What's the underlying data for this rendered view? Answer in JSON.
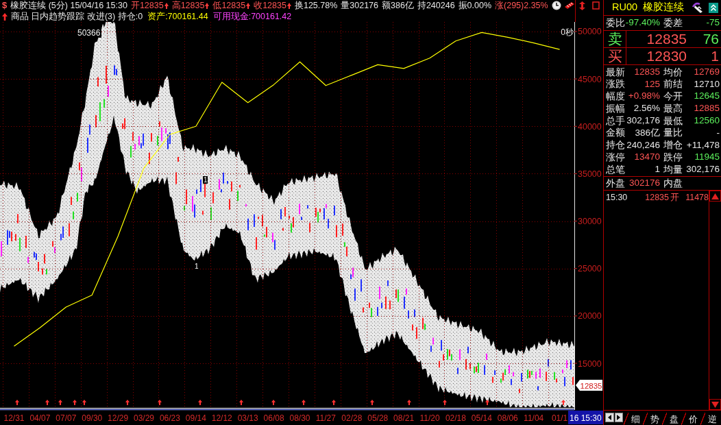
{
  "quote_bar": {
    "glyph": "$",
    "items": [
      {
        "text": "橡胶连续 (5分) 15/04/16 15:30"
      },
      {
        "text": "开12835",
        "color": "#ff5555",
        "marker": true
      },
      {
        "text": "高12835",
        "color": "#ff5555",
        "marker": true
      },
      {
        "text": "低12835",
        "color": "#ff5555",
        "marker": true
      },
      {
        "text": "收12835",
        "color": "#ff5555",
        "marker": true
      },
      {
        "text": "换125.78%"
      },
      {
        "text": "量302176"
      },
      {
        "text": "额386亿"
      },
      {
        "text": "持240246"
      },
      {
        "text": "振0.00%"
      },
      {
        "text": "涨(295)2.35%",
        "color": "#ff5555"
      }
    ]
  },
  "strategy_bar": {
    "items": [
      {
        "text": "商品 日内趋势跟踪 改进(3) 持仓:0"
      },
      {
        "text": "资产:700161.44",
        "color": "#ffff00"
      },
      {
        "text": "可用现金:700161.42",
        "color": "#ff44ff"
      }
    ]
  },
  "chart": {
    "high_label": "50366",
    "countdown": "0秒",
    "price_tag": "12835",
    "time_tag": "16 15:30",
    "chart_data": {
      "type": "line",
      "categories": [
        "12/31",
        "04/07",
        "07/07",
        "09/30",
        "12/29",
        "03/29",
        "06/23",
        "09/14",
        "12/12",
        "03/13",
        "06/08",
        "08/30",
        "11/27",
        "02/28",
        "05/28",
        "08/21",
        "11/20",
        "02/18",
        "05/14",
        "08/06",
        "11/04",
        "01/1"
      ],
      "ylim": [
        10230,
        51010
      ],
      "yticks": [
        15000,
        20000,
        25000,
        30000,
        35000,
        40000,
        45000,
        50000
      ],
      "grid": true,
      "series": [
        {
          "color": "#ffff00",
          "values": [
            16800,
            18760,
            20930,
            22200,
            28400,
            35600,
            39150,
            40000,
            44650,
            42500,
            44400,
            46800,
            44300,
            45400,
            46500,
            46100,
            47200,
            49000,
            49900,
            49400,
            48800,
            48100
          ]
        }
      ],
      "annotations": [
        "1",
        "1"
      ]
    }
  },
  "quote_panel": {
    "code": "RU00",
    "name": "橡胶连续",
    "ratio": [
      {
        "label": "委比",
        "value": "-97.40%",
        "color": "#5cf05c"
      },
      {
        "label": "委差",
        "value": "-75",
        "color": "#5cf05c"
      }
    ],
    "book": [
      {
        "label": {
          "text": "卖",
          "color": "#5cf05c"
        },
        "price": {
          "text": "12835",
          "color": "#ff5555"
        },
        "volume": {
          "text": "76",
          "color": "#5cf05c"
        }
      },
      {
        "label": {
          "text": "买",
          "color": "#ff5555"
        },
        "price": {
          "text": "12830",
          "color": "#ff5555"
        },
        "volume": {
          "text": "1",
          "color": "#ff5555"
        }
      }
    ],
    "stats": [
      {
        "label": "最新",
        "value": "12835",
        "color": "#ff5555"
      },
      {
        "label": "均价",
        "value": "12769",
        "color": "#ff5555"
      },
      {
        "label": "涨跌",
        "value": "125",
        "color": "#ff5555"
      },
      {
        "label": "前结",
        "value": "12710"
      },
      {
        "label": "幅度",
        "value": "+0.98%",
        "color": "#ff5555"
      },
      {
        "label": "今开",
        "value": "12645",
        "color": "#5cf05c"
      },
      {
        "label": "振幅",
        "value": "2.56%"
      },
      {
        "label": "最高",
        "value": "12885",
        "color": "#ff5555"
      },
      {
        "label": "总手",
        "value": "302,176"
      },
      {
        "label": "最低",
        "value": "12560",
        "color": "#5cf05c"
      },
      {
        "label": "金额",
        "value": "386亿"
      },
      {
        "label": "量比",
        "value": "-"
      },
      {
        "label": "持仓",
        "value": "240,246"
      },
      {
        "label": "增仓",
        "value": "+11,478"
      },
      {
        "label": "涨停",
        "value": "13470",
        "color": "#ff5555"
      },
      {
        "label": "跌停",
        "value": "11945",
        "color": "#5cf05c"
      },
      {
        "label": "总笔",
        "value": "1"
      },
      {
        "label": "均量",
        "value": "302,176"
      }
    ],
    "flow": [
      {
        "label": "外盘",
        "value": "302176",
        "color": "#ff5555"
      },
      {
        "label": "内盘"
      }
    ],
    "ticks": [
      {
        "time": "15:30",
        "price": "12835",
        "flag": "开",
        "volume": "11478"
      }
    ],
    "tabs": [
      {
        "label": "细",
        "selected": false
      },
      {
        "label": "势",
        "selected": false
      },
      {
        "label": "盘",
        "selected": false
      },
      {
        "label": "价",
        "selected": false
      },
      {
        "label": "逆",
        "selected": false
      }
    ]
  }
}
